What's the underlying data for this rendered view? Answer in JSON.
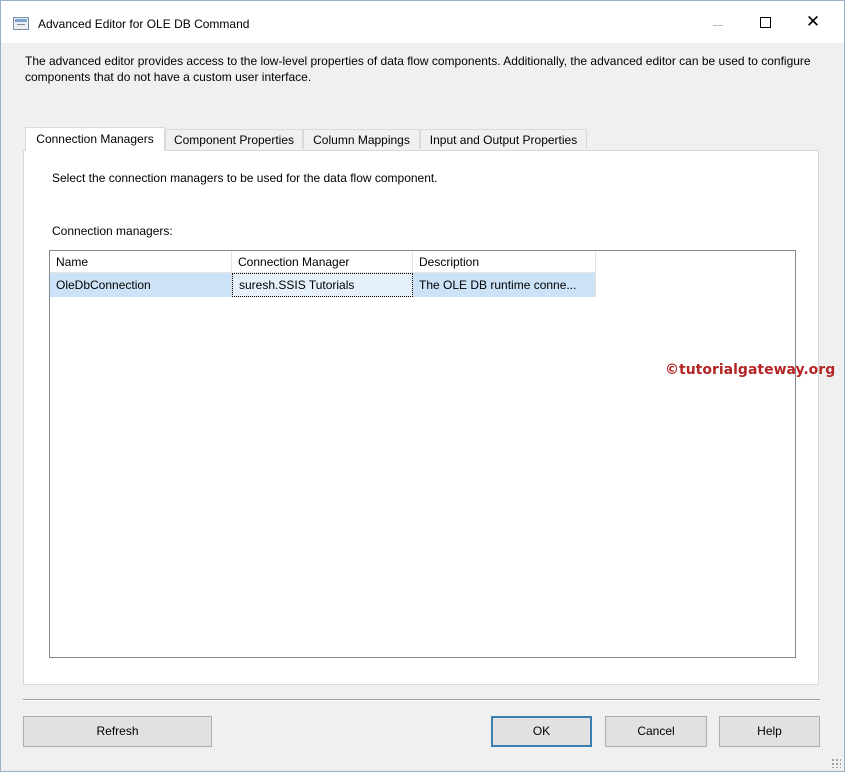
{
  "window": {
    "title": "Advanced Editor for OLE DB Command",
    "description": "The advanced editor provides access to the low-level properties of data flow components. Additionally, the advanced editor can be used to configure components that do not have a custom user interface."
  },
  "tabs": [
    {
      "label": "Connection Managers",
      "active": true
    },
    {
      "label": "Component Properties",
      "active": false
    },
    {
      "label": "Column Mappings",
      "active": false
    },
    {
      "label": "Input and Output Properties",
      "active": false
    }
  ],
  "panel": {
    "instruction": "Select the connection managers to be used for the data flow component.",
    "list_label": "Connection managers:"
  },
  "grid": {
    "columns": [
      "Name",
      "Connection Manager",
      "Description"
    ],
    "rows": [
      {
        "name": "OleDbConnection",
        "connection_manager": "suresh.SSIS Tutorials",
        "description": "The OLE DB runtime conne...",
        "selected": true
      }
    ]
  },
  "watermark": "©tutorialgateway.org",
  "buttons": {
    "refresh": "Refresh",
    "ok": "OK",
    "cancel": "Cancel",
    "help": "Help"
  },
  "icons": {
    "app": "editor-window-icon",
    "minimize": "minimize-icon",
    "maximize": "maximize-icon",
    "close": "close-icon",
    "resize": "resize-grip-icon"
  },
  "colors": {
    "selection": "#cce3f7",
    "default_button_border": "#3c7fb1",
    "watermark": "#b32525"
  }
}
